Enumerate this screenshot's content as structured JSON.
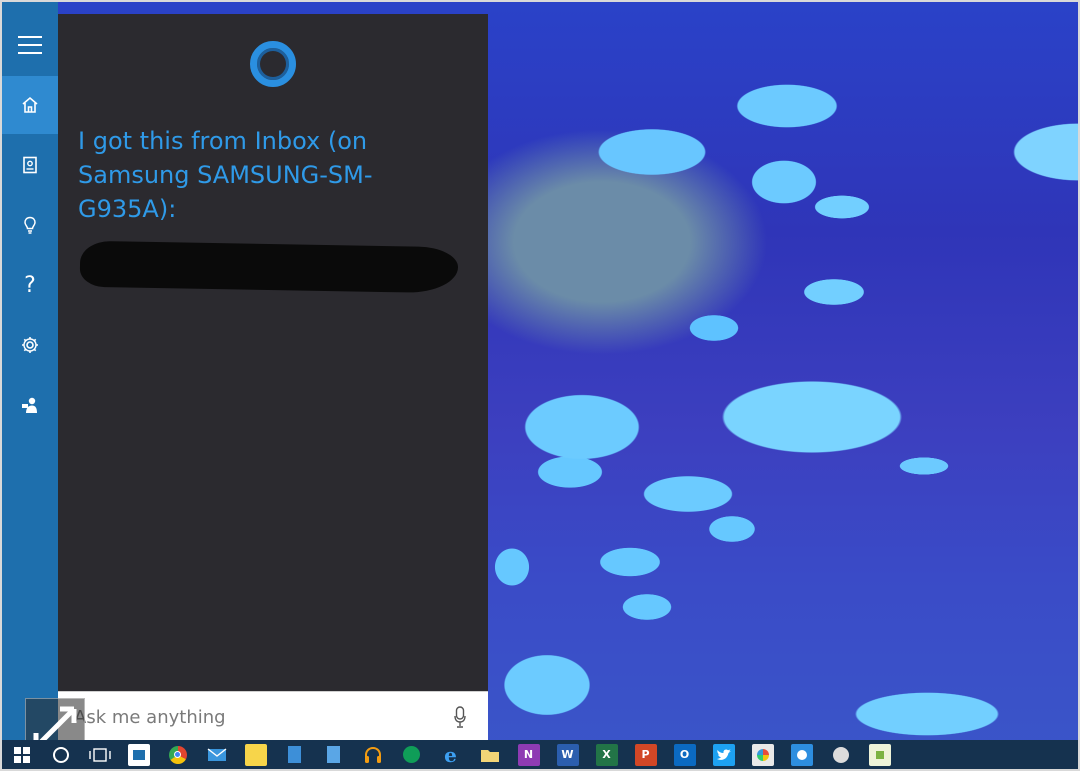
{
  "cortana": {
    "message": "I got this from Inbox (on Samsung SAMSUNG-SM-G935A):",
    "search_placeholder": "Ask me anything"
  },
  "rail": {
    "items": [
      {
        "name": "menu",
        "icon": "hamburger-icon"
      },
      {
        "name": "home",
        "icon": "home-icon",
        "active": true
      },
      {
        "name": "notebook",
        "icon": "notebook-icon"
      },
      {
        "name": "reminders",
        "icon": "lightbulb-icon"
      },
      {
        "name": "help",
        "icon": "question-icon",
        "label": "?"
      },
      {
        "name": "settings",
        "icon": "gear-icon"
      },
      {
        "name": "feedback",
        "icon": "feedback-icon"
      }
    ]
  },
  "taskbar": {
    "items": [
      {
        "name": "start",
        "icon": "windows-logo-icon"
      },
      {
        "name": "cortana",
        "icon": "cortana-circle-icon"
      },
      {
        "name": "task-view",
        "icon": "task-view-icon"
      },
      {
        "name": "store",
        "icon": "store-icon"
      },
      {
        "name": "chrome",
        "icon": "chrome-icon"
      },
      {
        "name": "mail",
        "icon": "mail-icon"
      },
      {
        "name": "sticky-notes",
        "icon": "sticky-notes-icon"
      },
      {
        "name": "document",
        "icon": "document-icon"
      },
      {
        "name": "notes",
        "icon": "notes-icon"
      },
      {
        "name": "headphones",
        "icon": "headphones-icon"
      },
      {
        "name": "hangouts",
        "icon": "hangouts-icon"
      },
      {
        "name": "edge",
        "icon": "edge-icon"
      },
      {
        "name": "file-explorer",
        "icon": "folder-icon"
      },
      {
        "name": "onenote",
        "icon": "onenote-icon",
        "label": "N"
      },
      {
        "name": "word",
        "icon": "word-icon",
        "label": "W"
      },
      {
        "name": "excel",
        "icon": "excel-icon",
        "label": "X"
      },
      {
        "name": "powerpoint",
        "icon": "powerpoint-icon",
        "label": "P"
      },
      {
        "name": "outlook",
        "icon": "outlook-icon",
        "label": "O"
      },
      {
        "name": "twitter",
        "icon": "twitter-icon"
      },
      {
        "name": "paint",
        "icon": "paint-icon"
      },
      {
        "name": "messaging",
        "icon": "messaging-icon"
      },
      {
        "name": "feedback",
        "icon": "feedback-icon"
      },
      {
        "name": "app",
        "icon": "app-tile-icon"
      }
    ]
  },
  "colors": {
    "rail": "#1e6fad",
    "rail_active": "#2f8ad0",
    "panel": "#2b2a2f",
    "accent": "#2f9ae8",
    "taskbar": "#15324f"
  }
}
